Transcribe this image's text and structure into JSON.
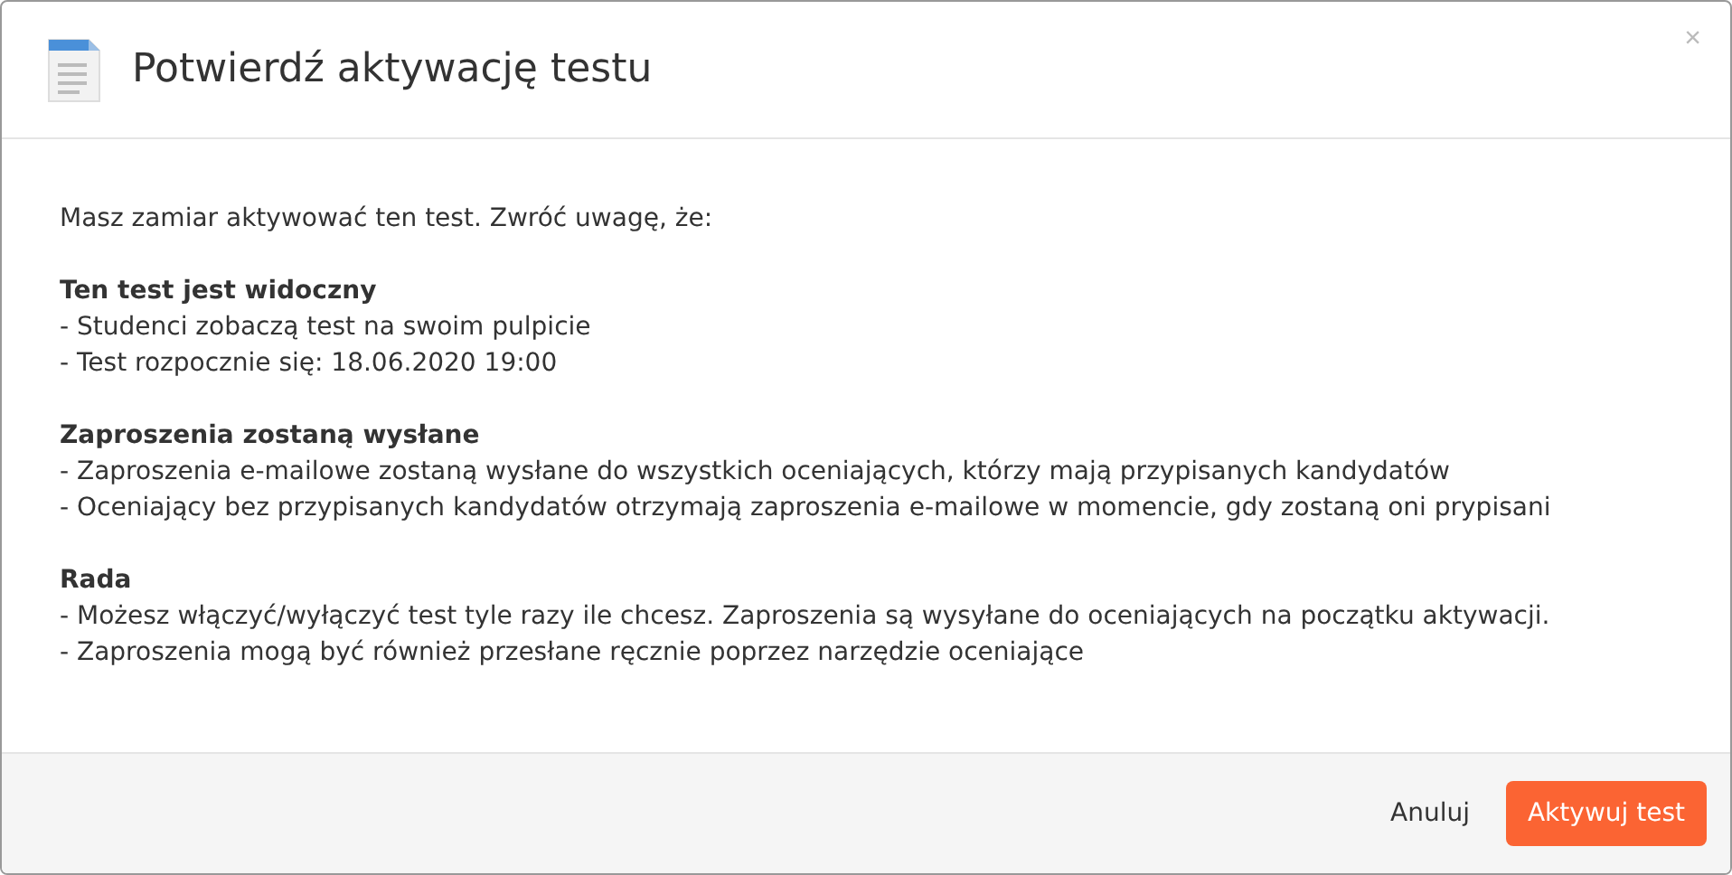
{
  "dialog": {
    "title": "Potwierdź aktywację testu",
    "close": "×"
  },
  "intro": "Masz zamiar aktywować ten test. Zwróć uwagę, że:",
  "sections": [
    {
      "heading": "Ten test jest widoczny",
      "lines": [
        "- Studenci zobaczą test na swoim pulpicie",
        "- Test rozpocznie się: 18.06.2020 19:00"
      ]
    },
    {
      "heading": "Zaproszenia zostaną wysłane",
      "lines": [
        "- Zaproszenia e-mailowe zostaną wysłane do wszystkich oceniających, którzy mają przypisanych kandydatów",
        "- Oceniający bez przypisanych kandydatów otrzymają zaproszenia e-mailowe w momencie, gdy zostaną oni prypisani"
      ]
    },
    {
      "heading": "Rada",
      "lines": [
        "- Możesz włączyć/wyłączyć test tyle razy ile chcesz. Zaproszenia są wysyłane do oceniających na początku aktywacji.",
        "- Zaproszenia mogą być również przesłane ręcznie poprzez narzędzie oceniające"
      ]
    }
  ],
  "buttons": [
    {
      "label": "Anuluj",
      "kind": "link"
    },
    {
      "label": "Aktywuj test",
      "kind": "primary"
    }
  ]
}
